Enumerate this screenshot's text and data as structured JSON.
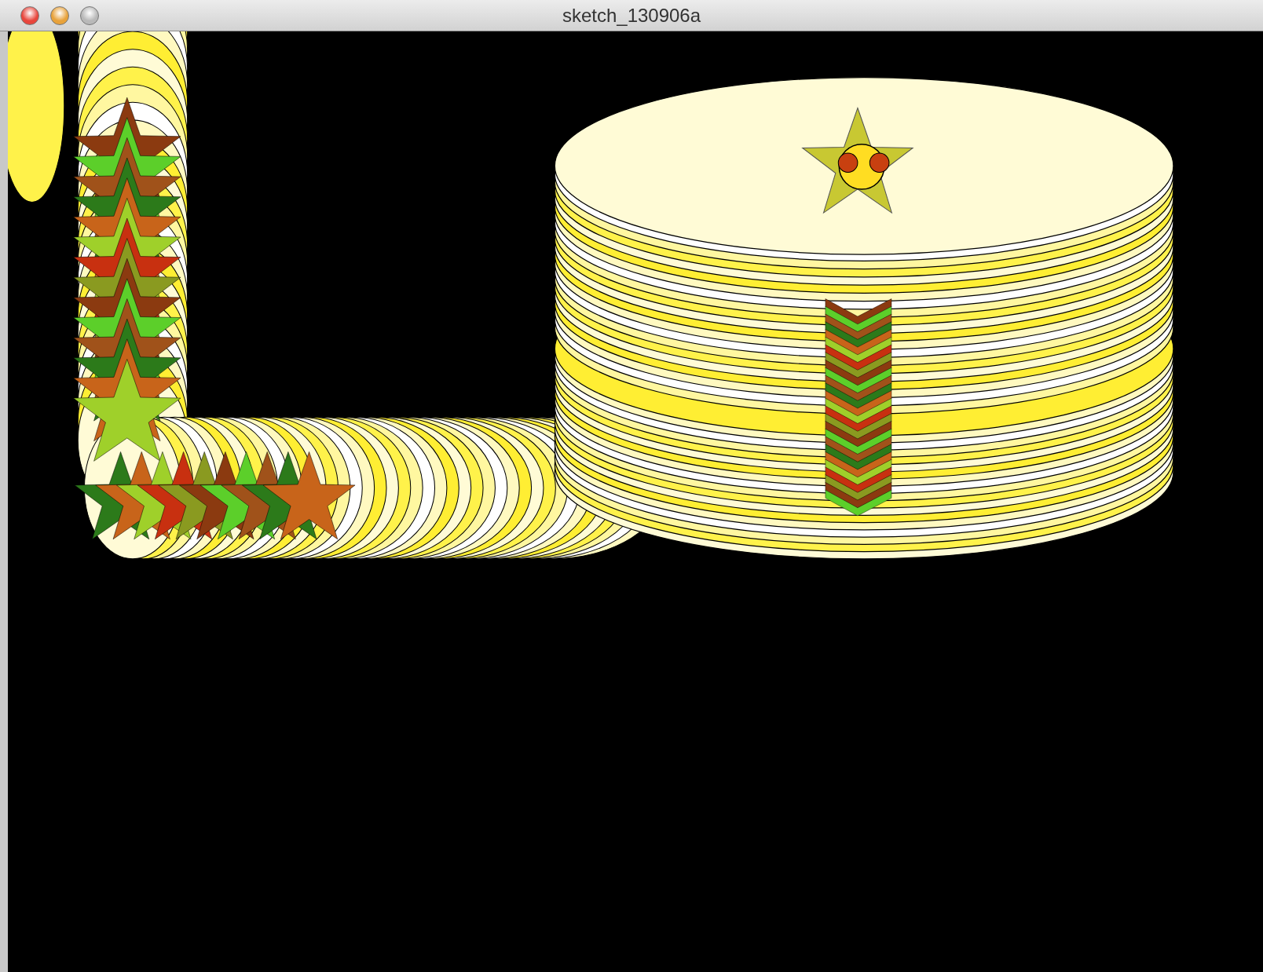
{
  "window": {
    "title": "sketch_130906a"
  }
}
